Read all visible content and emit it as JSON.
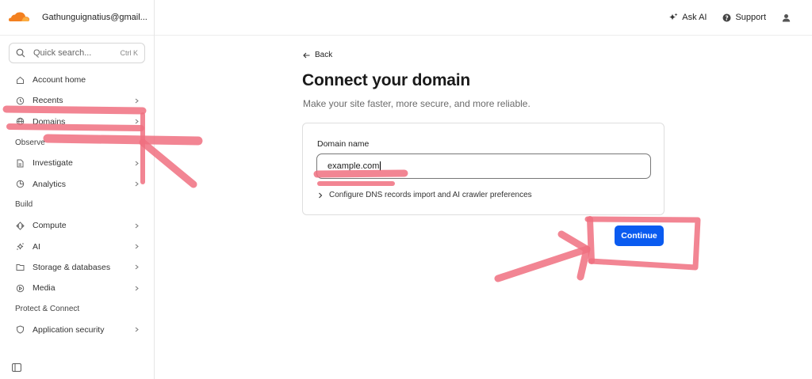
{
  "account": {
    "name": "Gathunguignatius@gmail...",
    "logo": "cloudflare-logo"
  },
  "search": {
    "placeholder": "Quick search...",
    "shortcut": "Ctrl K"
  },
  "sidebar": {
    "items": [
      {
        "label": "Account home",
        "icon": "home-icon",
        "chevron": false
      },
      {
        "label": "Recents",
        "icon": "clock-icon",
        "chevron": true
      },
      {
        "label": "Domains",
        "icon": "globe-icon",
        "chevron": true
      }
    ],
    "sections": [
      {
        "title": "Observe",
        "items": [
          {
            "label": "Investigate",
            "icon": "document-search-icon"
          },
          {
            "label": "Analytics",
            "icon": "pie-chart-icon"
          }
        ]
      },
      {
        "title": "Build",
        "items": [
          {
            "label": "Compute",
            "icon": "compute-icon"
          },
          {
            "label": "AI",
            "icon": "sparkle-icon"
          },
          {
            "label": "Storage & databases",
            "icon": "folder-icon"
          },
          {
            "label": "Media",
            "icon": "play-icon"
          }
        ]
      },
      {
        "title": "Protect & Connect",
        "items": [
          {
            "label": "Application security",
            "icon": "shield-icon"
          }
        ]
      }
    ]
  },
  "topbar": {
    "ask_ai": "Ask AI",
    "support": "Support"
  },
  "main": {
    "back": "Back",
    "title": "Connect your domain",
    "subtitle": "Make your site faster, more secure, and more reliable.",
    "field_label": "Domain name",
    "field_value": "example.com",
    "dns_toggle": "Configure DNS records import and AI crawler preferences",
    "continue": "Continue"
  },
  "colors": {
    "accent": "#0a5bf0",
    "annotation": "#f07080",
    "logo": "#f38020"
  }
}
